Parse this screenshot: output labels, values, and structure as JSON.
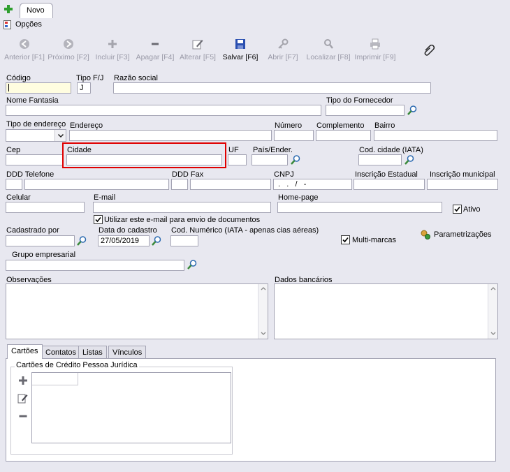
{
  "top_tab": {
    "label": "Novo"
  },
  "options": {
    "label": "Opções"
  },
  "toolbar": {
    "anterior": "Anterior [F1]",
    "proximo": "Próximo [F2]",
    "incluir": "Incluir [F3]",
    "apagar": "Apagar [F4]",
    "alterar": "Alterar [F5]",
    "salvar": "Salvar [F6]",
    "abrir": "Abrir [F7]",
    "localizar": "Localizar [F8]",
    "imprimir": "Imprimir [F9]"
  },
  "form": {
    "codigo_label": "Código",
    "tipo_fj_label": "Tipo F/J",
    "tipo_fj_value": "J",
    "razao_social_label": "Razão social",
    "nome_fantasia_label": "Nome Fantasia",
    "tipo_fornecedor_label": "Tipo do Fornecedor",
    "tipo_endereco_label": "Tipo de endereço",
    "endereco_label": "Endereço",
    "numero_label": "Número",
    "complemento_label": "Complemento",
    "bairro_label": "Bairro",
    "cep_label": "Cep",
    "cidade_label": "Cidade",
    "uf_label": "UF",
    "pais_label": "País/Ender.",
    "cod_cidade_label": "Cod. cidade (IATA)",
    "ddd_telefone_label": "DDD Telefone",
    "ddd_fax_label": "DDD Fax",
    "cnpj_label": "CNPJ",
    "cnpj_mask": " .   .   /   -",
    "inscricao_estadual_label": "Inscrição Estadual",
    "inscricao_municipal_label": "Inscrição municipal",
    "celular_label": "Celular",
    "email_label": "E-mail",
    "homepage_label": "Home-page",
    "ativo_label": "Ativo",
    "utilizar_email_label": "Utilizar este e-mail para envio de documentos",
    "cadastrado_por_label": "Cadastrado por",
    "data_cadastro_label": "Data do cadastro",
    "data_cadastro_value": "27/05/2019",
    "cod_numerico_label": "Cod. Numérico (IATA - apenas cias aéreas)",
    "multimarcas_label": "Multi-marcas",
    "parametrizacoes_label": "Parametrizações",
    "grupo_empresarial_label": "Grupo empresarial",
    "observacoes_label": "Observações",
    "dados_bancarios_label": "Dados bancários"
  },
  "bottom_tabs": [
    "Cartões",
    "Contatos",
    "Listas",
    "Vínculos"
  ],
  "cartoes": {
    "group_label": "Cartões de Crédito Pessoa Jurídica"
  },
  "colors": {
    "highlight": "#e00000",
    "background": "#e8e8f0",
    "accent_green": "#2e9e2e"
  }
}
